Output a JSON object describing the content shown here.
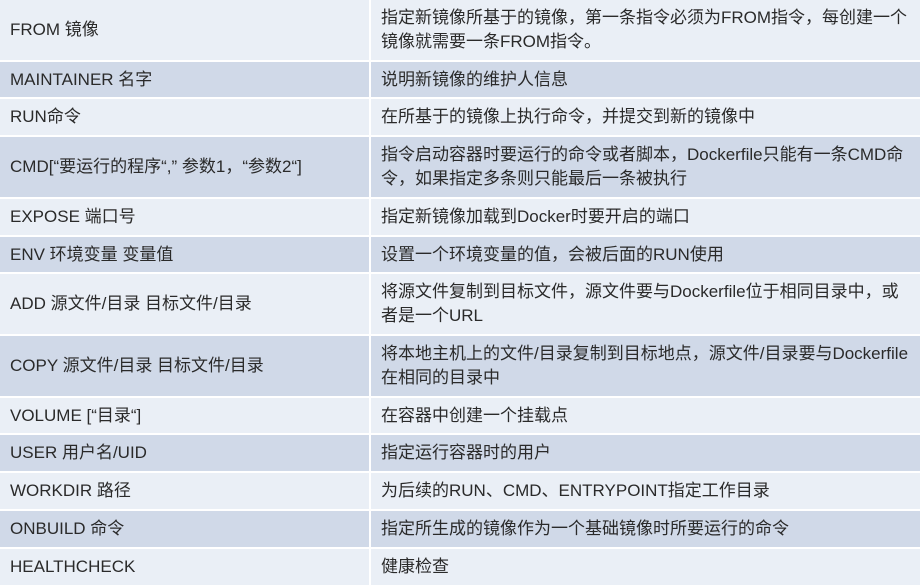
{
  "rows": [
    {
      "cmd": "FROM 镜像",
      "desc": "指定新镜像所基于的镜像，第一条指令必须为FROM指令，每创建一个镜像就需要一条FROM指令。"
    },
    {
      "cmd": "MAINTAINER 名字",
      "desc": "说明新镜像的维护人信息"
    },
    {
      "cmd": "RUN命令",
      "desc": "在所基于的镜像上执行命令，并提交到新的镜像中"
    },
    {
      "cmd": "CMD[“要运行的程序“,” 参数1，“参数2“]",
      "desc": "指令启动容器时要运行的命令或者脚本，Dockerfile只能有一条CMD命令，如果指定多条则只能最后一条被执行"
    },
    {
      "cmd": "EXPOSE 端口号",
      "desc": "指定新镜像加载到Docker时要开启的端口"
    },
    {
      "cmd": "ENV 环境变量 变量值",
      "desc": "设置一个环境变量的值，会被后面的RUN使用"
    },
    {
      "cmd": "ADD 源文件/目录 目标文件/目录",
      "desc": "将源文件复制到目标文件，源文件要与Dockerfile位于相同目录中，或者是一个URL"
    },
    {
      "cmd": "COPY 源文件/目录 目标文件/目录",
      "desc": "将本地主机上的文件/目录复制到目标地点，源文件/目录要与Dockerfile在相同的目录中"
    },
    {
      "cmd": "VOLUME [“目录“]",
      "desc": "在容器中创建一个挂载点"
    },
    {
      "cmd": "USER 用户名/UID",
      "desc": "指定运行容器时的用户"
    },
    {
      "cmd": "WORKDIR 路径",
      "desc": "为后续的RUN、CMD、ENTRYPOINT指定工作目录"
    },
    {
      "cmd": "ONBUILD 命令",
      "desc": "指定所生成的镜像作为一个基础镜像时所要运行的命令"
    },
    {
      "cmd": "HEALTHCHECK",
      "desc": "健康检查"
    }
  ],
  "watermark": ""
}
